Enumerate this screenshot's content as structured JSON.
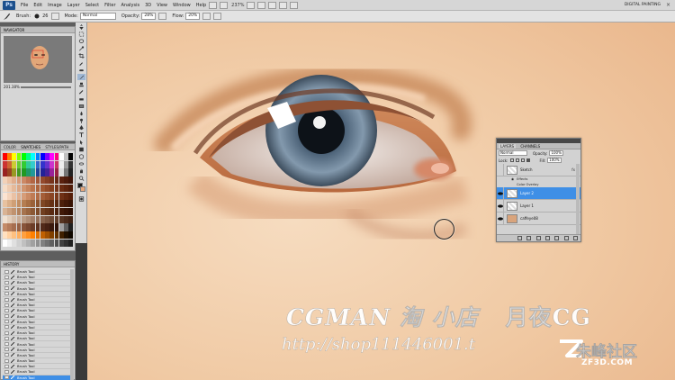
{
  "menubar": {
    "logo": "Ps",
    "items": [
      "File",
      "Edit",
      "Image",
      "Layer",
      "Select",
      "Filter",
      "Analysis",
      "3D",
      "View",
      "Window",
      "Help"
    ],
    "zoom": "237%",
    "workspace": "DIGITAL PAINTING"
  },
  "options": {
    "tool_label": "Brush:",
    "brush_size": "26",
    "mode_label": "Mode:",
    "mode_value": "Normal",
    "opacity_label": "Opacity:",
    "opacity_value": "28%",
    "flow_label": "Flow:",
    "flow_value": "20%"
  },
  "navigator": {
    "tab": "NAVIGATOR",
    "zoom": "201.38%"
  },
  "swatches": {
    "tabs": [
      "COLOR",
      "SWATCHES",
      "STYLES/PATH"
    ]
  },
  "history": {
    "tab": "HISTORY",
    "states": [
      "Brush Tool",
      "Brush Tool",
      "Brush Tool",
      "Brush Tool",
      "Brush Tool",
      "Brush Tool",
      "Brush Tool",
      "Brush Tool",
      "Brush Tool",
      "Brush Tool",
      "Brush Tool",
      "Brush Tool",
      "Brush Tool",
      "Brush Tool",
      "Brush Tool",
      "Brush Tool",
      "Brush Tool",
      "Brush Tool",
      "Brush Tool",
      "Brush Tool"
    ],
    "current_index": 19
  },
  "layers": {
    "tabs": [
      "LAYERS",
      "CHANNELS"
    ],
    "blend_mode": "Normal",
    "opacity_label": "Opacity:",
    "opacity": "100%",
    "lock_label": "Lock:",
    "fill_label": "Fill:",
    "fill": "100%",
    "items": [
      {
        "name": "Sketch",
        "selected": false,
        "fx": "fx"
      },
      {
        "name": "Layer 2",
        "selected": true,
        "fx": ""
      },
      {
        "name": "Layer 1",
        "selected": false,
        "fx": ""
      },
      {
        "name": "caffeye08",
        "selected": false,
        "fx": ""
      }
    ],
    "effects_label": "Effects",
    "effect_name": "Color Overlay"
  },
  "watermark": {
    "line1": "CGMAN 淘 小店",
    "line1b": "月夜CG",
    "line2": "http://shop111446001.t",
    "brand": "朱峰社区",
    "site": "ZF3D.COM"
  },
  "colors": {
    "ui_gray": "#d6d6d6",
    "selection": "#3f8fe6",
    "skin_light": "#f3d2b0",
    "skin_mid": "#e6b084",
    "iris": "#5b7186"
  }
}
